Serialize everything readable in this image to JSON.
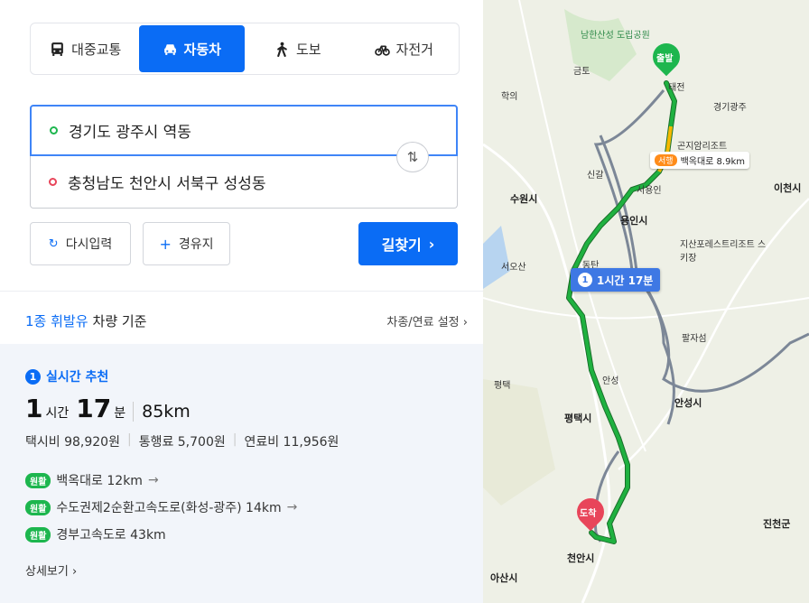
{
  "tabs": [
    {
      "label": "대중교통",
      "icon": "bus-icon",
      "active": false
    },
    {
      "label": "자동차",
      "icon": "car-icon",
      "active": true
    },
    {
      "label": "도보",
      "icon": "walk-icon",
      "active": false
    },
    {
      "label": "자전거",
      "icon": "bike-icon",
      "active": false
    }
  ],
  "origin": "경기도 광주시 역동",
  "destination": "충청남도 천안시 서북구 성성동",
  "buttons": {
    "reset": "다시입력",
    "via": "경유지",
    "search": "길찾기"
  },
  "vehicle": {
    "highlight": "1종 휘발유",
    "rest": "차량 기준",
    "settings": "차종/연료 설정"
  },
  "result": {
    "rank": "1",
    "recommend": "실시간 추천",
    "hours": "1",
    "hours_unit": "시간",
    "minutes": "17",
    "minutes_unit": "분",
    "distance": "85km",
    "taxi": "택시비 98,920원",
    "toll": "통행료 5,700원",
    "fuel": "연료비 11,956원",
    "roads": [
      {
        "badge": "원활",
        "name": "백옥대로 12km",
        "arrow": "→"
      },
      {
        "badge": "원활",
        "name": "수도권제2순환고속도로(화성-광주) 14km",
        "arrow": "→"
      },
      {
        "badge": "원활",
        "name": "경부고속도로 43km",
        "arrow": ""
      }
    ],
    "detail": "상세보기"
  },
  "map": {
    "route_label": "1시간 17분",
    "route_num": "1",
    "road_tag": "서행",
    "road_label": "백옥대로 8.9km",
    "start_label": "출발",
    "end_label": "도착",
    "places": [
      "남한산성 도립공원",
      "수원시",
      "용인시",
      "이천시",
      "지산포레스트리조트 스키장",
      "팔자섬",
      "평택시",
      "안성시",
      "천안시",
      "아산시",
      "진천군",
      "곤지암리조트",
      "경기광주",
      "태전",
      "금토",
      "학의",
      "서오산",
      "신갈",
      "동탄",
      "안성",
      "평택",
      "서용인"
    ],
    "route_colors": {
      "normal": "#1fb140",
      "slow": "#f5b800",
      "alt": "#7c8797"
    }
  }
}
